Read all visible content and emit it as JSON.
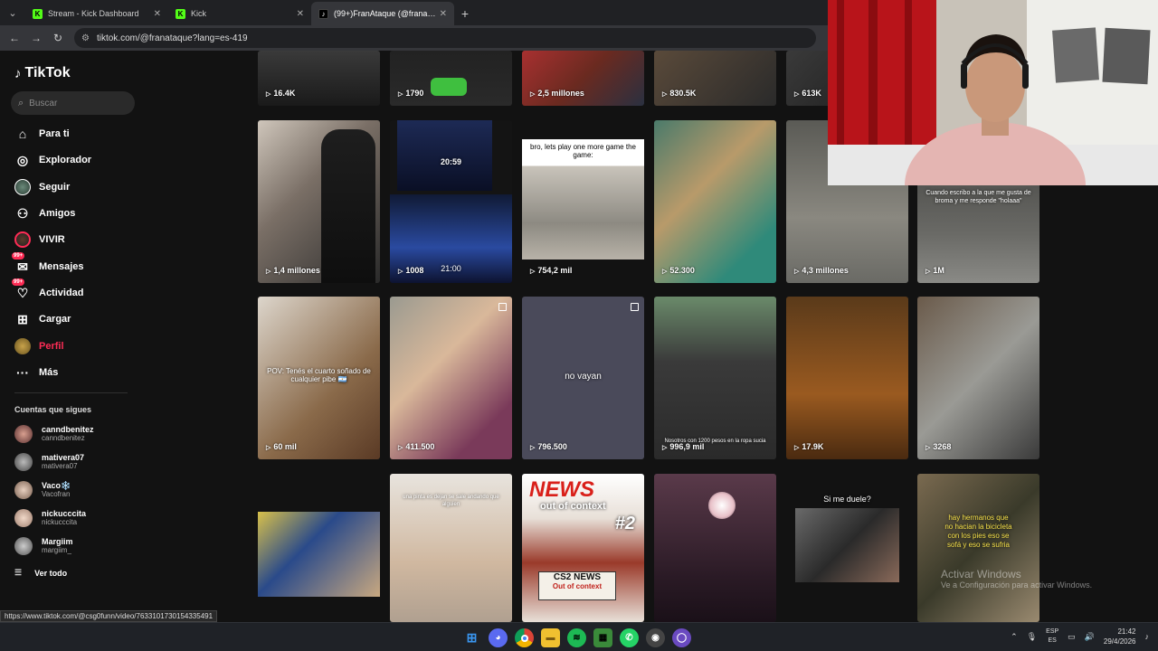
{
  "browser": {
    "tabs": [
      {
        "title": "Stream - Kick Dashboard",
        "icon": "kick-icon"
      },
      {
        "title": "Kick",
        "icon": "kick-icon"
      },
      {
        "title": "(99+)FranAtaque (@franataque",
        "icon": "tiktok-icon"
      }
    ],
    "url": "tiktok.com/@franataque?lang=es-419",
    "status_url": "https://www.tiktok.com/@csg0funn/video/7633101730154335491"
  },
  "sidebar": {
    "brand": "TikTok",
    "search_placeholder": "Buscar",
    "nav": [
      {
        "label": "Para ti",
        "icon": "home-icon"
      },
      {
        "label": "Explorador",
        "icon": "compass-icon"
      },
      {
        "label": "Seguir",
        "icon": "avatar-icon"
      },
      {
        "label": "Amigos",
        "icon": "friends-icon"
      },
      {
        "label": "VIVIR",
        "icon": "live-icon"
      },
      {
        "label": "Mensajes",
        "icon": "messages-icon",
        "badge": "99+"
      },
      {
        "label": "Actividad",
        "icon": "activity-icon",
        "badge": "99+"
      },
      {
        "label": "Cargar",
        "icon": "upload-icon"
      },
      {
        "label": "Perfil",
        "icon": "profile-avatar-icon"
      },
      {
        "label": "Más",
        "icon": "more-icon"
      }
    ],
    "following_title": "Cuentas que sigues",
    "following": [
      {
        "name": "canndbenitez",
        "handle": "canndbenitez"
      },
      {
        "name": "mativera07",
        "handle": "mativera07"
      },
      {
        "name": "Vaco❄️",
        "handle": "Vacofran"
      },
      {
        "name": "nickucccita",
        "handle": "nickucccita"
      },
      {
        "name": "Margiim",
        "handle": "margiim_"
      }
    ],
    "see_all": "Ver todo"
  },
  "grid": {
    "row0": [
      "16.4K",
      "1790",
      "2,5 millones",
      "830.5K",
      "613K"
    ],
    "row1": [
      "1,4 millones",
      "1008",
      "754,2 mil",
      "52.300",
      "4,3 millones",
      "1M"
    ],
    "row2": [
      "60 mil",
      "411.500",
      "796.500",
      "996,9 mil",
      "17.9K",
      "3268"
    ],
    "captions": {
      "r1c1_top": "20:59",
      "r1c1_bottom": "21:00",
      "r1c2": "bro, lets play one more game the game:",
      "r1c5": "Cuando escribo a la que me gusta de broma y me responde \"holaaa\"",
      "r2c0": "POV: Tenés el cuarto soñado de cualquier pibe 🇦🇷",
      "r2c2": "no vayan",
      "r2c3": "Nosotros con 1200 pesos en la ropa sucia",
      "r3c1": "una pinta es dejan se sale andando que alguien",
      "r3c2_news": "NEWS",
      "r3c2_ooc": "out of context",
      "r3c2_num": "#2",
      "r3c2_paper1": "CS2 NEWS",
      "r3c2_paper2": "Out of context",
      "r3c4": "Si me duele?",
      "r3c5": "hay hermanos que no hacian la bicicleta con los pies eso se sofá y eso se sufria"
    }
  },
  "watermark": {
    "line1": "Activar Windows",
    "line2": "Ve a Configuración para activar Windows."
  },
  "taskbar": {
    "lang_top": "ESP",
    "lang_bottom": "ES",
    "time": "21:42",
    "date": "29/4/2026"
  }
}
